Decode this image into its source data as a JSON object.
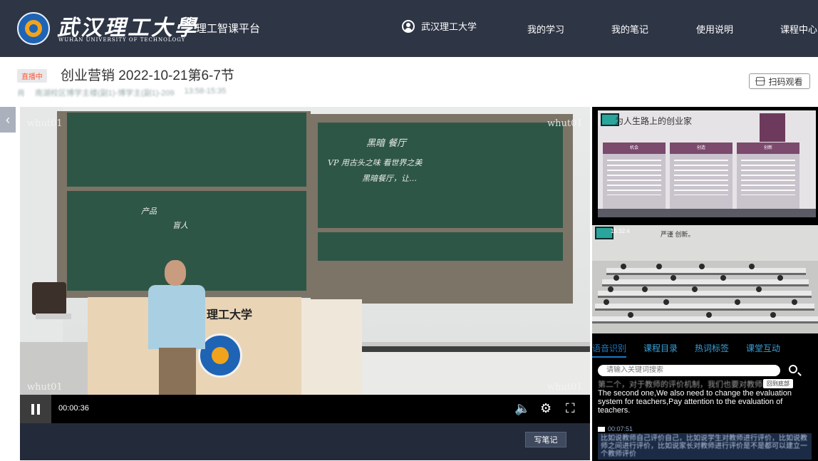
{
  "header": {
    "logo_text": "武汉理工大學",
    "logo_subtext": "WUHAN UNIVERSITY OF TECHNOLOGY",
    "platform_name": "理工智课平台",
    "user_name": "武汉理工大学",
    "nav_items": [
      "我的学习",
      "我的笔记",
      "使用说明",
      "课程中心"
    ],
    "background_color": "#2e3545"
  },
  "course": {
    "live_badge": "直播中",
    "title": "创业营销 2022-10-21第6-7节",
    "teacher": "肖",
    "location": "南湖校区博学主楼(副1)-博学主(副1)-209",
    "time_range": "13:58-15:35",
    "scan_button": "扫码观看"
  },
  "player": {
    "watermark": "whut01",
    "elapsed_time": "00:00:36",
    "write_note_button": "写笔记",
    "board_text": {
      "right_board": [
        "黑暗 餐厅",
        "VP  用古头之味 看世界之美",
        "黑暗餐厅，让…"
      ],
      "left_board": [
        "产品",
        "盲人"
      ]
    },
    "podium_text": "理工大学"
  },
  "side_panel": {
    "slide_title": "为人生路上的创业家",
    "slide_cards": [
      "机会",
      "创造",
      "创新"
    ],
    "classroom_time": "15:32:4",
    "classroom_board_text": "严谨 创新。",
    "tabs": [
      "语音识别",
      "课程目录",
      "热词标签",
      "课堂互动"
    ],
    "active_tab": "语音识别",
    "search_placeholder": "请输入关键词搜索",
    "back_to_live": "回到底部",
    "transcript_cn_1": "第二个，对于教师的评价机制，我们也要对教师的评价。",
    "transcript_en_1": "The second one,We also need to change the evaluation system for teachers,Pay attention to the evaluation of teachers.",
    "timestamp_2": "00:07:51",
    "transcript_cn_2": "比如说教师自己评价自己，比如说学生对教师进行评价，比如说教师之间进行评价，比如说家长对教师进行评价是不是都可以建立一个教师评价"
  }
}
